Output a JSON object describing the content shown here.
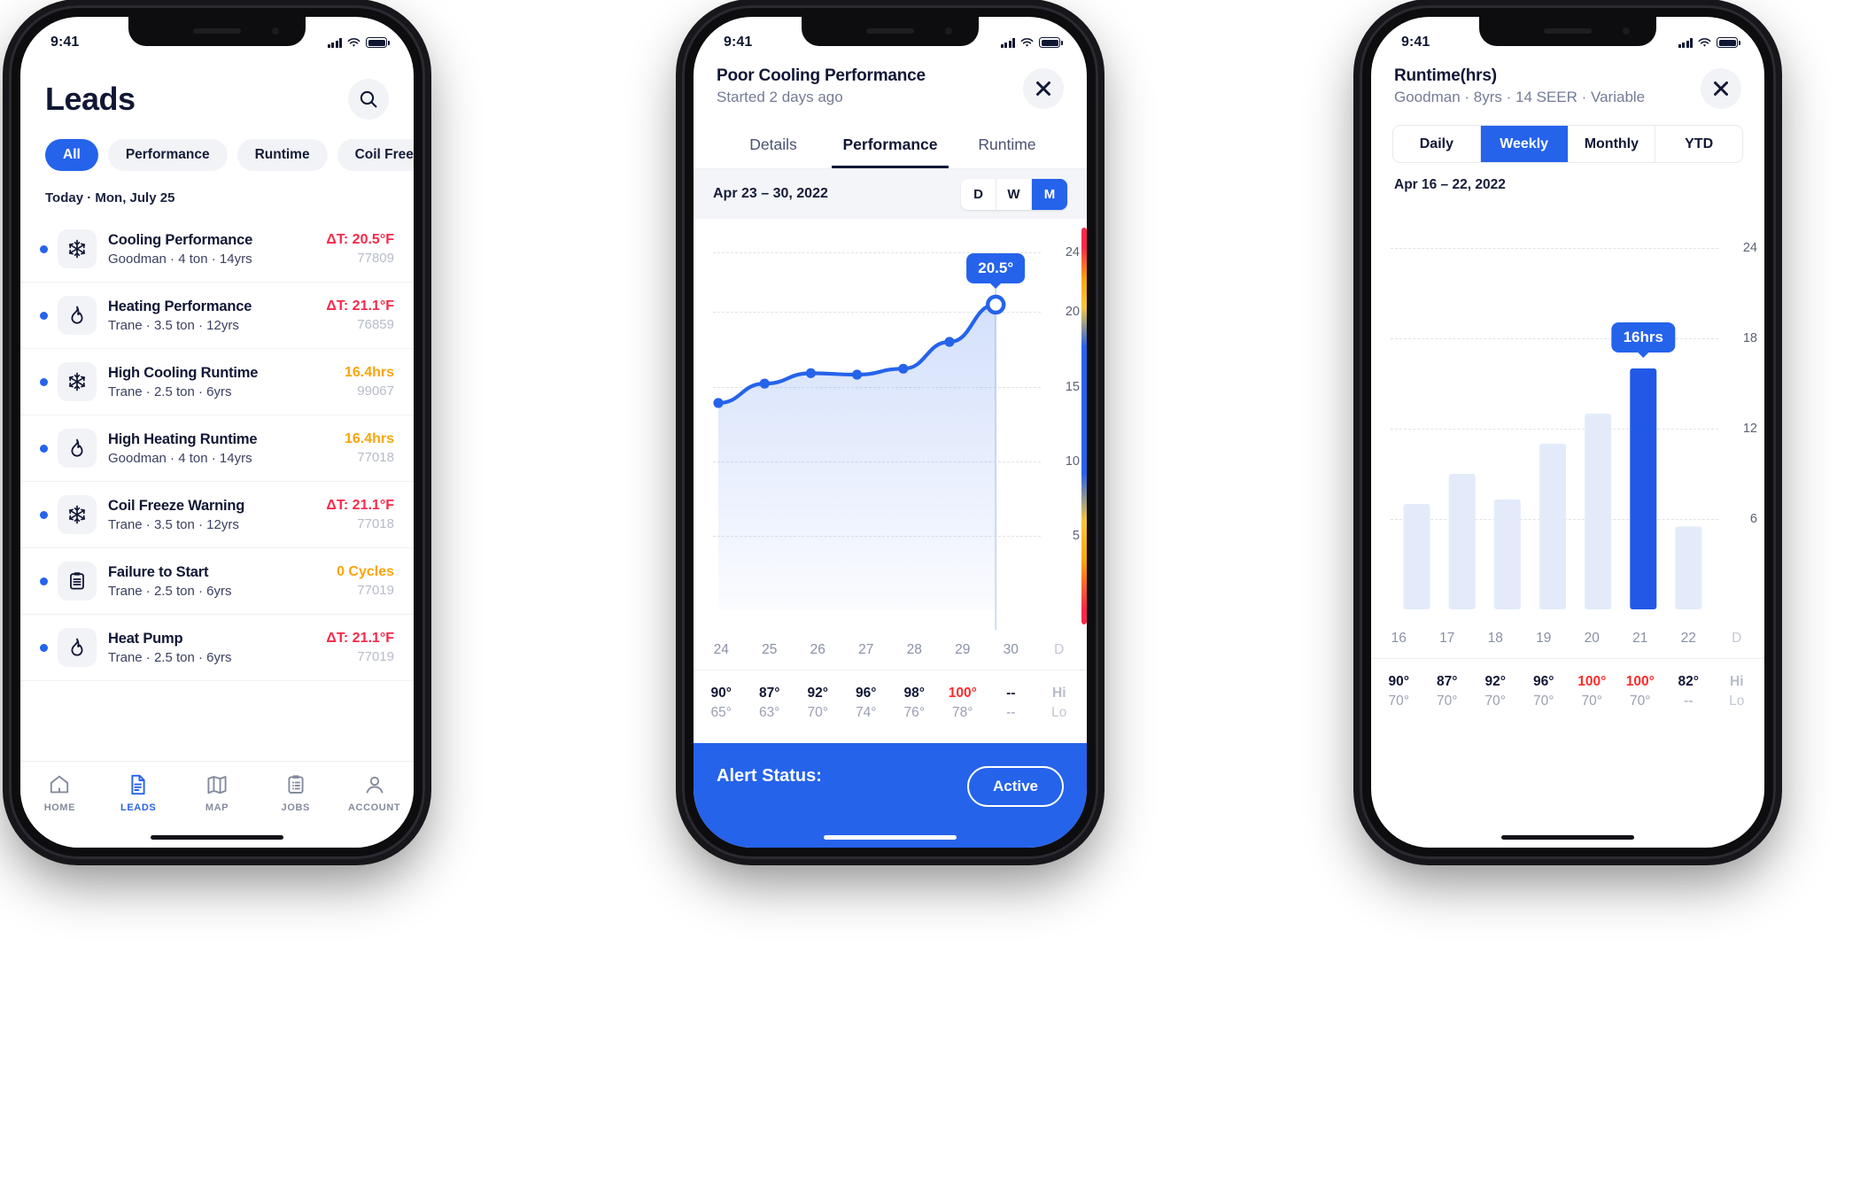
{
  "colors": {
    "brand_blue": "#2563eb",
    "alert_red": "#f8294a",
    "warn_amber": "#f9a50a",
    "ink": "#111735",
    "muted": "#8990a6"
  },
  "phone1": {
    "status": {
      "time": "9:41"
    },
    "header": {
      "title": "Leads",
      "search_icon": "search-icon"
    },
    "filters": [
      {
        "label": "All",
        "active": true
      },
      {
        "label": "Performance",
        "active": false
      },
      {
        "label": "Runtime",
        "active": false
      },
      {
        "label": "Coil Free",
        "active": false
      }
    ],
    "day_label": "Today · Mon, July 25",
    "leads": [
      {
        "icon": "snowflake-icon",
        "name": "Cooling Performance",
        "sub": "Goodman · 4 ton · 14yrs",
        "metric": "ΔT: 20.5°F",
        "metric_tone": "red",
        "id": "77809"
      },
      {
        "icon": "flame-icon",
        "name": "Heating Performance",
        "sub": "Trane · 3.5 ton · 12yrs",
        "metric": "ΔT: 21.1°F",
        "metric_tone": "red",
        "id": "76859"
      },
      {
        "icon": "snowflake-icon",
        "name": "High Cooling Runtime",
        "sub": "Trane · 2.5 ton · 6yrs",
        "metric": "16.4hrs",
        "metric_tone": "amber",
        "id": "99067"
      },
      {
        "icon": "flame-icon",
        "name": "High Heating Runtime",
        "sub": "Goodman · 4 ton · 14yrs",
        "metric": "16.4hrs",
        "metric_tone": "amber",
        "id": "77018"
      },
      {
        "icon": "snowflake-icon",
        "name": "Coil Freeze Warning",
        "sub": "Trane · 3.5 ton · 12yrs",
        "metric": "ΔT: 21.1°F",
        "metric_tone": "red",
        "id": "77018"
      },
      {
        "icon": "clipboard-icon",
        "name": "Failure to Start",
        "sub": "Trane · 2.5 ton · 6yrs",
        "metric": "0 Cycles",
        "metric_tone": "amber",
        "id": "77019"
      },
      {
        "icon": "flame-icon",
        "name": "Heat Pump",
        "sub": "Trane · 2.5 ton · 6yrs",
        "metric": "ΔT: 21.1°F",
        "metric_tone": "red",
        "id": "77019"
      }
    ],
    "tabbar": [
      {
        "label": "HOME",
        "icon": "home-icon",
        "active": false
      },
      {
        "label": "LEADS",
        "icon": "document-icon",
        "active": true
      },
      {
        "label": "MAP",
        "icon": "map-icon",
        "active": false
      },
      {
        "label": "JOBS",
        "icon": "clipboard-list-icon",
        "active": false
      },
      {
        "label": "ACCOUNT",
        "icon": "account-icon",
        "active": false
      }
    ]
  },
  "phone2": {
    "status": {
      "time": "9:41"
    },
    "header": {
      "title": "Poor Cooling Performance",
      "subtitle": "Started 2 days ago",
      "close_icon": "close-icon"
    },
    "tabs": [
      {
        "label": "Details",
        "active": false
      },
      {
        "label": "Performance",
        "active": true
      },
      {
        "label": "Runtime",
        "active": false
      }
    ],
    "range_label": "Apr 23 – 30, 2022",
    "granularity": [
      {
        "label": "D",
        "active": false
      },
      {
        "label": "W",
        "active": false
      },
      {
        "label": "M",
        "active": true
      }
    ],
    "tooltip": "20.5°",
    "alert": {
      "label": "Alert Status:",
      "status_button": "Active"
    }
  },
  "phone3": {
    "status": {
      "time": "9:41"
    },
    "header": {
      "title": "Runtime(hrs)",
      "subtitle": "Goodman · 8yrs · 14 SEER · Variable",
      "close_icon": "close-icon"
    },
    "segments": [
      {
        "label": "Daily",
        "active": false
      },
      {
        "label": "Weekly",
        "active": true
      },
      {
        "label": "Monthly",
        "active": false
      },
      {
        "label": "YTD",
        "active": false
      }
    ],
    "week_label": "Apr 16 – 22, 2022",
    "tooltip": "16hrs"
  },
  "chart_data": [
    {
      "type": "line",
      "title": "Poor Cooling Performance — Performance",
      "xlabel": "",
      "ylabel": "",
      "ylim": [
        0,
        24
      ],
      "yticks": [
        5,
        10,
        15,
        20,
        24
      ],
      "grid": true,
      "categories": [
        "24",
        "25",
        "26",
        "27",
        "28",
        "29",
        "30"
      ],
      "x_axis_trailing_label": "D",
      "values": [
        13.9,
        15.2,
        15.9,
        15.8,
        16.2,
        18.0,
        20.5
      ],
      "highlight_index": 6,
      "highlight_label": "20.5°",
      "table": {
        "row_labels": [
          "Hi",
          "Lo"
        ],
        "hi": [
          "90°",
          "87°",
          "92°",
          "96°",
          "98°",
          "100°",
          "--"
        ],
        "lo": [
          "65°",
          "63°",
          "70°",
          "74°",
          "76°",
          "78°",
          "--"
        ],
        "hi_hot_index": 5
      }
    },
    {
      "type": "bar",
      "title": "Runtime(hrs) — Weekly",
      "xlabel": "",
      "ylabel": "",
      "ylim": [
        0,
        24
      ],
      "yticks": [
        6,
        12,
        18,
        24
      ],
      "grid": true,
      "categories": [
        "16",
        "17",
        "18",
        "19",
        "20",
        "21",
        "22"
      ],
      "x_axis_trailing_label": "D",
      "values": [
        7.0,
        9.0,
        7.3,
        11.0,
        13.0,
        16.0,
        5.5
      ],
      "highlight_index": 5,
      "highlight_label": "16hrs",
      "table": {
        "row_labels": [
          "Hi",
          "Lo"
        ],
        "hi": [
          "90°",
          "87°",
          "92°",
          "96°",
          "100°",
          "100°",
          "82°"
        ],
        "lo": [
          "70°",
          "70°",
          "70°",
          "70°",
          "70°",
          "70°",
          "--"
        ],
        "hi_hot_indices": [
          4,
          5
        ]
      }
    }
  ]
}
